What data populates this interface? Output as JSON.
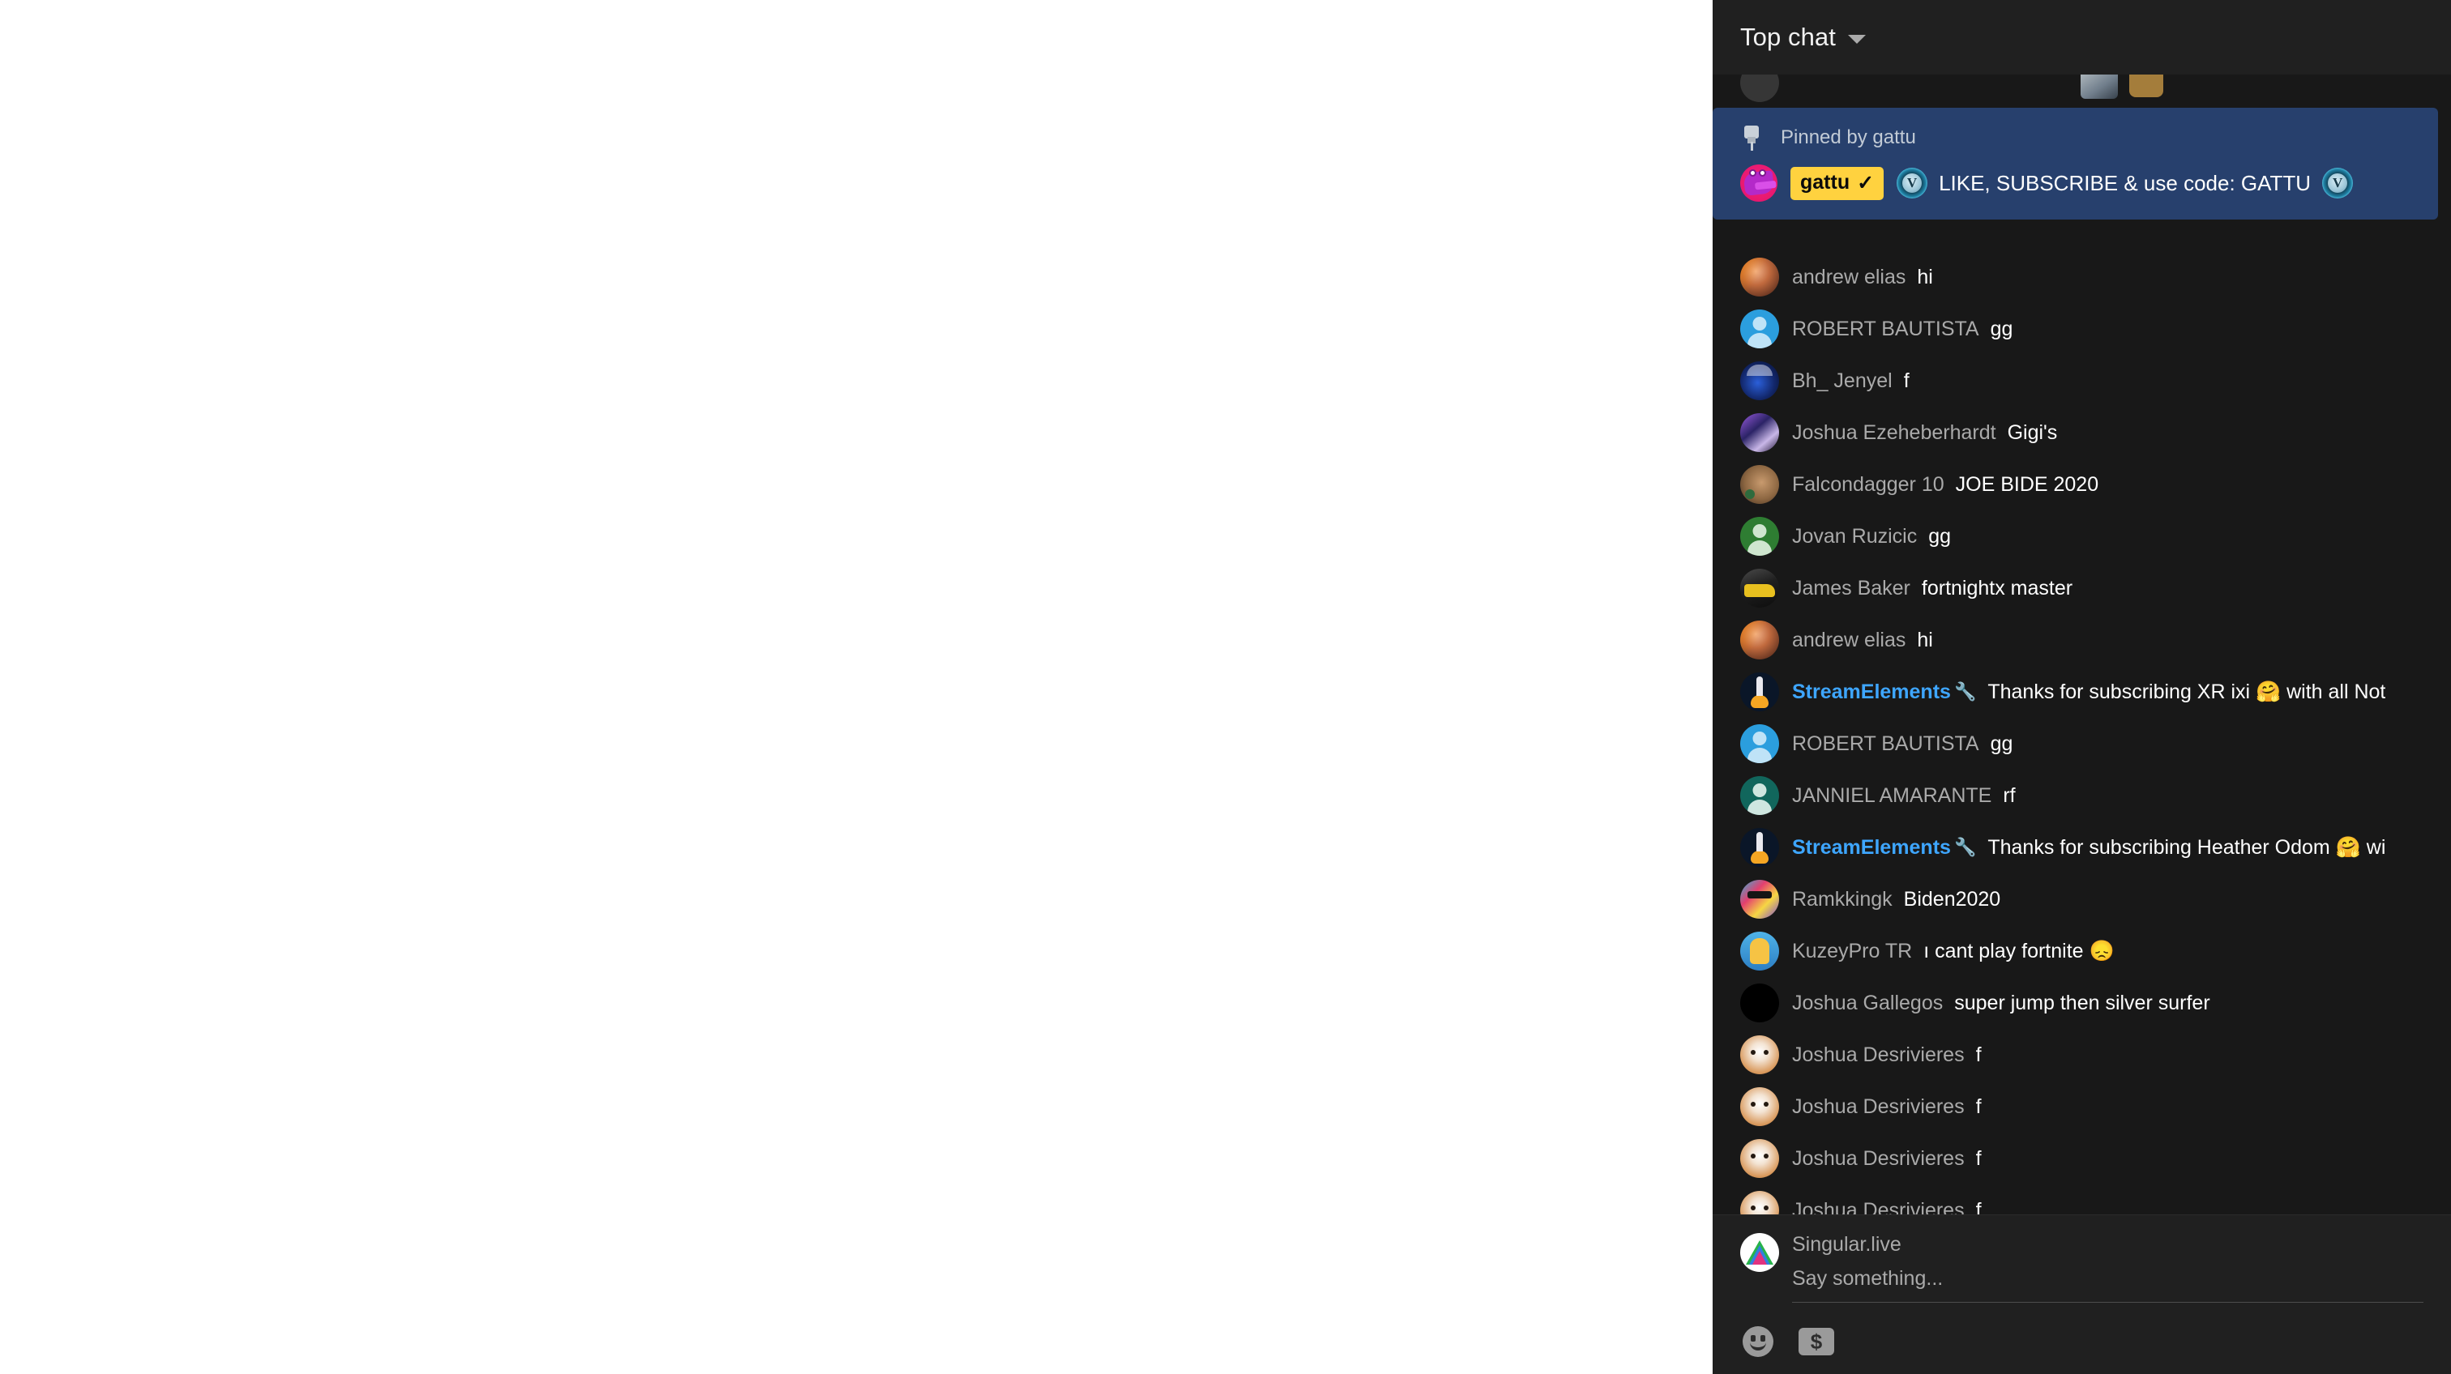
{
  "header": {
    "title": "Top chat",
    "caret_icon": "chevron-down-icon"
  },
  "pinned": {
    "pin_icon": "pin-icon",
    "label": "Pinned by gattu",
    "author_badge": "gattu",
    "verified_check": "✓",
    "text": "LIKE, SUBSCRIBE & use code: GATTU",
    "vbucks_icon": "vbucks-icon",
    "background_color": "#27406d",
    "badge_color": "#ffd23f"
  },
  "messages": [
    {
      "author": "andrew elias",
      "text": "hi",
      "avatar": "av-andrew",
      "bot": false
    },
    {
      "author": "ROBERT BAUTISTA",
      "text": "gg",
      "avatar": "av-person",
      "bot": false
    },
    {
      "author": "Bh_ Jenyel",
      "text": "f",
      "avatar": "av-bh",
      "bot": false
    },
    {
      "author": "Joshua Ezeheberhardt",
      "text": "Gigi's",
      "avatar": "av-joshuae",
      "bot": false
    },
    {
      "author": "Falcondagger 10",
      "text": "JOE BIDE 2020",
      "avatar": "av-falcon",
      "bot": false
    },
    {
      "author": "Jovan Ruzicic",
      "text": "gg",
      "avatar": "av-person green",
      "bot": false
    },
    {
      "author": "James Baker",
      "text": "fortnightx master",
      "avatar": "av-james",
      "bot": false
    },
    {
      "author": "andrew elias",
      "text": "hi",
      "avatar": "av-andrew",
      "bot": false
    },
    {
      "author": "StreamElements",
      "text": "Thanks for subscribing XR ixi 🤗 with all Not",
      "avatar": "av-se",
      "bot": true,
      "badge_icon": "wrench-icon"
    },
    {
      "author": "ROBERT BAUTISTA",
      "text": "gg",
      "avatar": "av-person",
      "bot": false
    },
    {
      "author": "JANNIEL AMARANTE",
      "text": "rf",
      "avatar": "av-person teal",
      "bot": false
    },
    {
      "author": "StreamElements",
      "text": "Thanks for subscribing Heather Odom 🤗 wi",
      "avatar": "av-se",
      "bot": true,
      "badge_icon": "wrench-icon"
    },
    {
      "author": "Ramkkingk",
      "text": "Biden2020",
      "avatar": "av-ram",
      "bot": false
    },
    {
      "author": "KuzeyPro TR",
      "text": "ı cant play fortnite 😞",
      "avatar": "av-kuzey",
      "bot": false
    },
    {
      "author": "Joshua Gallegos",
      "text": "super jump then silver surfer",
      "avatar": "av-black",
      "bot": false
    },
    {
      "author": "Joshua Desrivieres",
      "text": "f",
      "avatar": "av-cat",
      "bot": false
    },
    {
      "author": "Joshua Desrivieres",
      "text": "f",
      "avatar": "av-cat",
      "bot": false
    },
    {
      "author": "Joshua Desrivieres",
      "text": "f",
      "avatar": "av-cat",
      "bot": false
    },
    {
      "author": "Joshua Desrivieres",
      "text": "f",
      "avatar": "av-cat",
      "bot": false
    }
  ],
  "composer": {
    "account_name": "Singular.live",
    "input_placeholder": "Say something...",
    "input_value": "",
    "emoji_button_icon": "emoji-smiley-icon",
    "superchat_button_icon": "super-chat-dollar-icon"
  },
  "colors": {
    "panel_background": "#181818",
    "header_background": "#202020",
    "author_text": "#aaaaaa",
    "message_text": "#ffffff",
    "bot_name": "#3ea6ff"
  }
}
